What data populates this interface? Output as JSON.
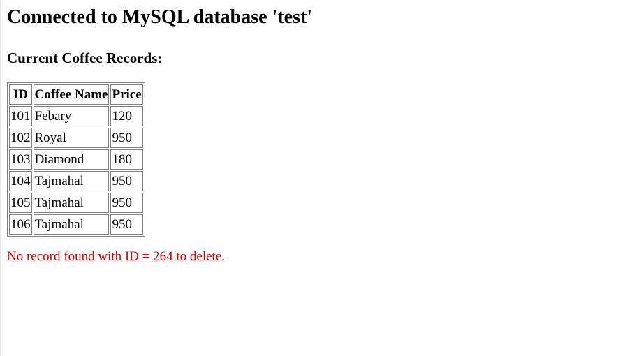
{
  "page": {
    "heading": "Connected to MySQL database 'test'",
    "subheading": "Current Coffee Records:",
    "status_message": "No record found with ID = 264 to delete.",
    "status_color": "#dd0000"
  },
  "table": {
    "headers": [
      "ID",
      "Coffee Name",
      "Price"
    ],
    "rows": [
      [
        "101",
        "Febary",
        "120"
      ],
      [
        "102",
        "Royal",
        "950"
      ],
      [
        "103",
        "Diamond",
        "180"
      ],
      [
        "104",
        "Tajmahal",
        "950"
      ],
      [
        "105",
        "Tajmahal",
        "950"
      ],
      [
        "106",
        "Tajmahal",
        "950"
      ]
    ]
  }
}
